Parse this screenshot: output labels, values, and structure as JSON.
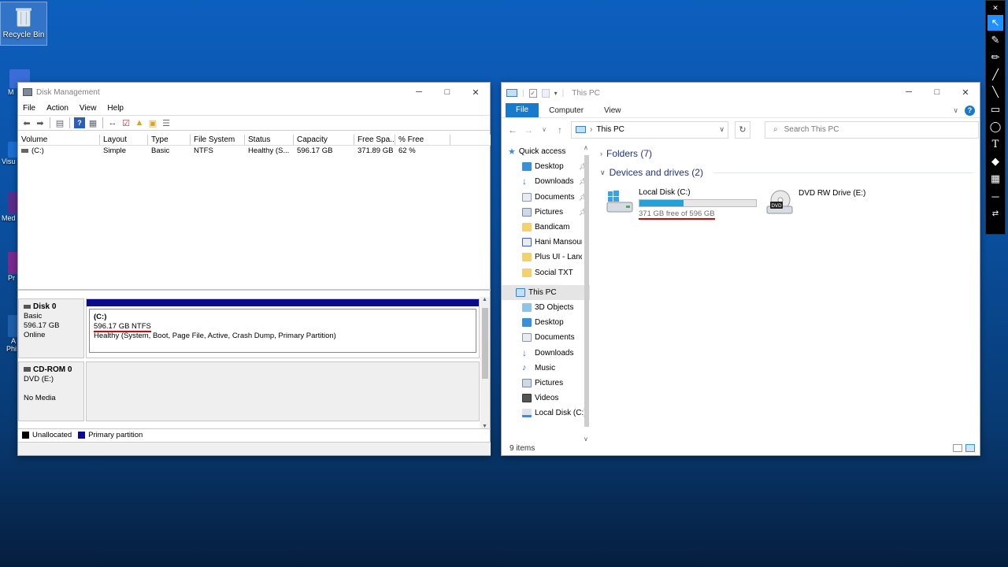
{
  "desktop": {
    "recycle_bin": "Recycle Bin",
    "partial_labels": [
      "M",
      "Visu",
      "Med",
      "Pr",
      "A",
      "Phi"
    ]
  },
  "disk_management": {
    "title": "Disk Management",
    "menu": [
      "File",
      "Action",
      "View",
      "Help"
    ],
    "columns": [
      "Volume",
      "Layout",
      "Type",
      "File System",
      "Status",
      "Capacity",
      "Free Spa...",
      "% Free"
    ],
    "volumes": [
      {
        "volume": "(C:)",
        "layout": "Simple",
        "type": "Basic",
        "fs": "NTFS",
        "status": "Healthy (S...",
        "capacity": "596.17 GB",
        "free": "371.89 GB",
        "pct_free": "62 %"
      }
    ],
    "disks": [
      {
        "name": "Disk 0",
        "type": "Basic",
        "size": "596.17 GB",
        "state": "Online",
        "partition": {
          "label": "(C:)",
          "size_fs": "596.17 GB NTFS",
          "status": "Healthy (System, Boot, Page File, Active, Crash Dump, Primary Partition)"
        }
      },
      {
        "name": "CD-ROM 0",
        "type": "DVD (E:)",
        "state": "No Media"
      }
    ],
    "legend": [
      "Unallocated",
      "Primary partition"
    ],
    "colors": {
      "primary_partition": "#0a0a8a",
      "unallocated": "#000000"
    }
  },
  "explorer": {
    "title": "This PC",
    "ribbon_tabs": [
      "File",
      "Computer",
      "View"
    ],
    "address": "This PC",
    "search_placeholder": "Search This PC",
    "nav": {
      "quick_access": "Quick access",
      "quick_items": [
        "Desktop",
        "Downloads",
        "Documents",
        "Pictures",
        "Bandicam",
        "Hani Mansour",
        "Plus UI - Landing",
        "Social TXT"
      ],
      "this_pc": "This PC",
      "pc_items": [
        "3D Objects",
        "Desktop",
        "Documents",
        "Downloads",
        "Music",
        "Pictures",
        "Videos",
        "Local Disk (C:)"
      ]
    },
    "groups": {
      "folders": "Folders (7)",
      "devices": "Devices and drives (2)"
    },
    "drives": [
      {
        "name": "Local Disk (C:)",
        "free_text": "371 GB free of 596 GB",
        "used_fraction": 0.38
      },
      {
        "name": "DVD RW Drive (E:)",
        "badge": "DVD"
      }
    ],
    "status": "9 items",
    "colors": {
      "accent": "#1979ca",
      "capacity_fill": "#26a0da"
    }
  },
  "drawbar": {
    "tools": [
      "cursor-icon",
      "pen-icon",
      "highlighter-icon",
      "line-icon",
      "brush-icon",
      "rectangle-icon",
      "ellipse-icon",
      "text-icon",
      "eraser-icon",
      "checker-icon",
      "minus-icon",
      "arrows-icon"
    ]
  }
}
